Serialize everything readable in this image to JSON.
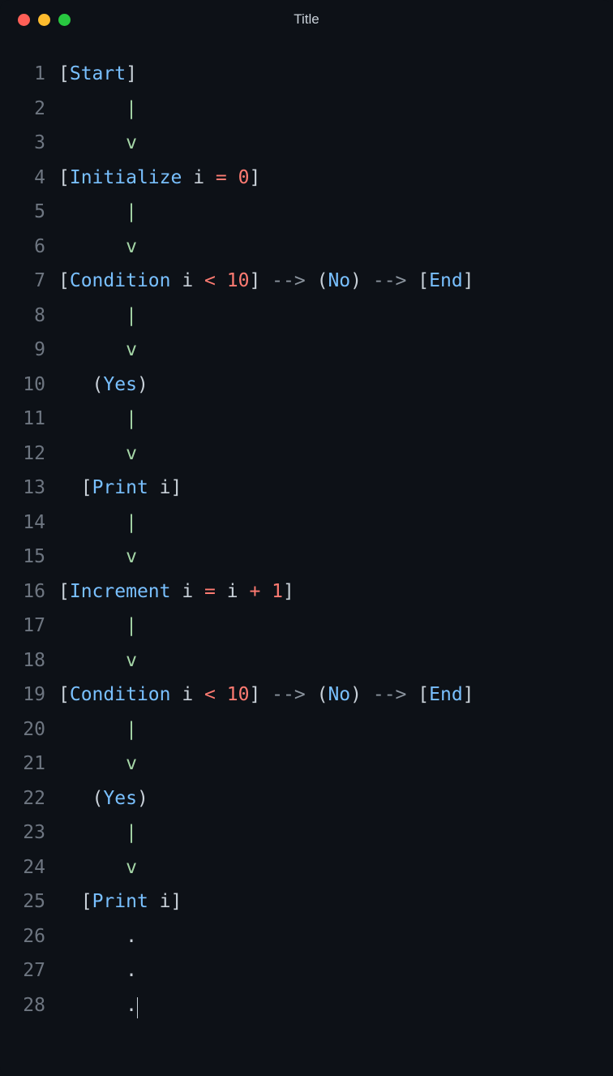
{
  "window": {
    "title": "Title"
  },
  "editor": {
    "cursor_line": 28,
    "lines": [
      {
        "n": 1,
        "tokens": [
          {
            "t": "[",
            "c": "bracket"
          },
          {
            "t": "Start",
            "c": "keyword"
          },
          {
            "t": "]",
            "c": "bracket"
          }
        ]
      },
      {
        "n": 2,
        "tokens": [
          {
            "t": "      ",
            "c": "ident"
          },
          {
            "t": "|",
            "c": "pipe"
          }
        ]
      },
      {
        "n": 3,
        "tokens": [
          {
            "t": "      ",
            "c": "ident"
          },
          {
            "t": "v",
            "c": "pipe"
          }
        ]
      },
      {
        "n": 4,
        "tokens": [
          {
            "t": "[",
            "c": "bracket"
          },
          {
            "t": "Initialize",
            "c": "keyword"
          },
          {
            "t": " i ",
            "c": "ident"
          },
          {
            "t": "=",
            "c": "op"
          },
          {
            "t": " ",
            "c": "ident"
          },
          {
            "t": "0",
            "c": "num"
          },
          {
            "t": "]",
            "c": "bracket"
          }
        ]
      },
      {
        "n": 5,
        "tokens": [
          {
            "t": "      ",
            "c": "ident"
          },
          {
            "t": "|",
            "c": "pipe"
          }
        ]
      },
      {
        "n": 6,
        "tokens": [
          {
            "t": "      ",
            "c": "ident"
          },
          {
            "t": "v",
            "c": "pipe"
          }
        ]
      },
      {
        "n": 7,
        "tokens": [
          {
            "t": "[",
            "c": "bracket"
          },
          {
            "t": "Condition",
            "c": "keyword"
          },
          {
            "t": " i ",
            "c": "ident"
          },
          {
            "t": "<",
            "c": "op"
          },
          {
            "t": " ",
            "c": "ident"
          },
          {
            "t": "10",
            "c": "num"
          },
          {
            "t": "]",
            "c": "bracket"
          },
          {
            "t": " ",
            "c": "ident"
          },
          {
            "t": "-->",
            "c": "arrow"
          },
          {
            "t": " ",
            "c": "ident"
          },
          {
            "t": "(",
            "c": "paren"
          },
          {
            "t": "No",
            "c": "keyword"
          },
          {
            "t": ")",
            "c": "paren"
          },
          {
            "t": " ",
            "c": "ident"
          },
          {
            "t": "-->",
            "c": "arrow"
          },
          {
            "t": " ",
            "c": "ident"
          },
          {
            "t": "[",
            "c": "bracket"
          },
          {
            "t": "End",
            "c": "keyword"
          },
          {
            "t": "]",
            "c": "bracket"
          }
        ]
      },
      {
        "n": 8,
        "tokens": [
          {
            "t": "      ",
            "c": "ident"
          },
          {
            "t": "|",
            "c": "pipe"
          }
        ]
      },
      {
        "n": 9,
        "tokens": [
          {
            "t": "      ",
            "c": "ident"
          },
          {
            "t": "v",
            "c": "pipe"
          }
        ]
      },
      {
        "n": 10,
        "tokens": [
          {
            "t": "   ",
            "c": "ident"
          },
          {
            "t": "(",
            "c": "paren"
          },
          {
            "t": "Yes",
            "c": "keyword"
          },
          {
            "t": ")",
            "c": "paren"
          }
        ]
      },
      {
        "n": 11,
        "tokens": [
          {
            "t": "      ",
            "c": "ident"
          },
          {
            "t": "|",
            "c": "pipe"
          }
        ]
      },
      {
        "n": 12,
        "tokens": [
          {
            "t": "      ",
            "c": "ident"
          },
          {
            "t": "v",
            "c": "pipe"
          }
        ]
      },
      {
        "n": 13,
        "tokens": [
          {
            "t": "  ",
            "c": "ident"
          },
          {
            "t": "[",
            "c": "bracket"
          },
          {
            "t": "Print",
            "c": "keyword"
          },
          {
            "t": " i",
            "c": "ident"
          },
          {
            "t": "]",
            "c": "bracket"
          }
        ]
      },
      {
        "n": 14,
        "tokens": [
          {
            "t": "      ",
            "c": "ident"
          },
          {
            "t": "|",
            "c": "pipe"
          }
        ]
      },
      {
        "n": 15,
        "tokens": [
          {
            "t": "      ",
            "c": "ident"
          },
          {
            "t": "v",
            "c": "pipe"
          }
        ]
      },
      {
        "n": 16,
        "tokens": [
          {
            "t": "[",
            "c": "bracket"
          },
          {
            "t": "Increment",
            "c": "keyword"
          },
          {
            "t": " i ",
            "c": "ident"
          },
          {
            "t": "=",
            "c": "op"
          },
          {
            "t": " i ",
            "c": "ident"
          },
          {
            "t": "+",
            "c": "op"
          },
          {
            "t": " ",
            "c": "ident"
          },
          {
            "t": "1",
            "c": "num"
          },
          {
            "t": "]",
            "c": "bracket"
          }
        ]
      },
      {
        "n": 17,
        "tokens": [
          {
            "t": "      ",
            "c": "ident"
          },
          {
            "t": "|",
            "c": "pipe"
          }
        ]
      },
      {
        "n": 18,
        "tokens": [
          {
            "t": "      ",
            "c": "ident"
          },
          {
            "t": "v",
            "c": "pipe"
          }
        ]
      },
      {
        "n": 19,
        "tokens": [
          {
            "t": "[",
            "c": "bracket"
          },
          {
            "t": "Condition",
            "c": "keyword"
          },
          {
            "t": " i ",
            "c": "ident"
          },
          {
            "t": "<",
            "c": "op"
          },
          {
            "t": " ",
            "c": "ident"
          },
          {
            "t": "10",
            "c": "num"
          },
          {
            "t": "]",
            "c": "bracket"
          },
          {
            "t": " ",
            "c": "ident"
          },
          {
            "t": "-->",
            "c": "arrow"
          },
          {
            "t": " ",
            "c": "ident"
          },
          {
            "t": "(",
            "c": "paren"
          },
          {
            "t": "No",
            "c": "keyword"
          },
          {
            "t": ")",
            "c": "paren"
          },
          {
            "t": " ",
            "c": "ident"
          },
          {
            "t": "-->",
            "c": "arrow"
          },
          {
            "t": " ",
            "c": "ident"
          },
          {
            "t": "[",
            "c": "bracket"
          },
          {
            "t": "End",
            "c": "keyword"
          },
          {
            "t": "]",
            "c": "bracket"
          }
        ]
      },
      {
        "n": 20,
        "tokens": [
          {
            "t": "      ",
            "c": "ident"
          },
          {
            "t": "|",
            "c": "pipe"
          }
        ]
      },
      {
        "n": 21,
        "tokens": [
          {
            "t": "      ",
            "c": "ident"
          },
          {
            "t": "v",
            "c": "pipe"
          }
        ]
      },
      {
        "n": 22,
        "tokens": [
          {
            "t": "   ",
            "c": "ident"
          },
          {
            "t": "(",
            "c": "paren"
          },
          {
            "t": "Yes",
            "c": "keyword"
          },
          {
            "t": ")",
            "c": "paren"
          }
        ]
      },
      {
        "n": 23,
        "tokens": [
          {
            "t": "      ",
            "c": "ident"
          },
          {
            "t": "|",
            "c": "pipe"
          }
        ]
      },
      {
        "n": 24,
        "tokens": [
          {
            "t": "      ",
            "c": "ident"
          },
          {
            "t": "v",
            "c": "pipe"
          }
        ]
      },
      {
        "n": 25,
        "tokens": [
          {
            "t": "  ",
            "c": "ident"
          },
          {
            "t": "[",
            "c": "bracket"
          },
          {
            "t": "Print",
            "c": "keyword"
          },
          {
            "t": " i",
            "c": "ident"
          },
          {
            "t": "]",
            "c": "bracket"
          }
        ]
      },
      {
        "n": 26,
        "tokens": [
          {
            "t": "      .",
            "c": "ident"
          }
        ]
      },
      {
        "n": 27,
        "tokens": [
          {
            "t": "      .",
            "c": "ident"
          }
        ]
      },
      {
        "n": 28,
        "tokens": [
          {
            "t": "      .",
            "c": "ident"
          }
        ]
      }
    ]
  }
}
